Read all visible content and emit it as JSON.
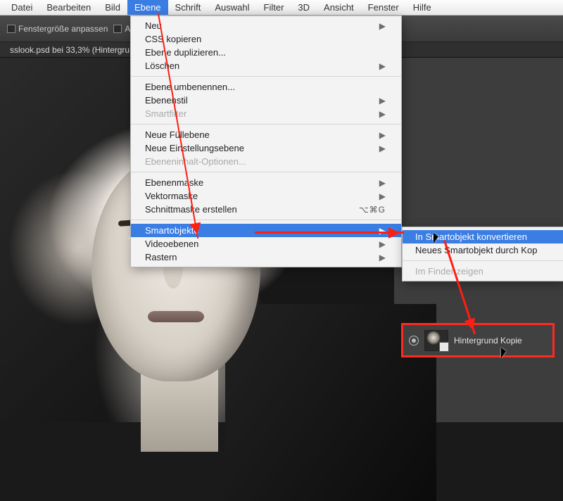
{
  "menubar": {
    "items": [
      "Datei",
      "Bearbeiten",
      "Bild",
      "Ebene",
      "Schrift",
      "Auswahl",
      "Filter",
      "3D",
      "Ansicht",
      "Fenster",
      "Hilfe"
    ],
    "active_index": 3
  },
  "toolbar": {
    "fit_window": "Fenstergröße anpassen",
    "all_windows": "Alle Fenster"
  },
  "document_tab": "sslook.psd bei 33,3% (Hintergrun",
  "dropdown": {
    "groups": [
      [
        {
          "label": "Neu",
          "sub": "▶"
        },
        {
          "label": "CSS kopieren"
        },
        {
          "label": "Ebene duplizieren..."
        },
        {
          "label": "Löschen",
          "sub": "▶"
        }
      ],
      [
        {
          "label": "Ebene umbenennen..."
        },
        {
          "label": "Ebenenstil",
          "sub": "▶"
        },
        {
          "label": "Smartfilter",
          "sub": "▶",
          "disabled": true
        }
      ],
      [
        {
          "label": "Neue Füllebene",
          "sub": "▶"
        },
        {
          "label": "Neue Einstellungsebene",
          "sub": "▶"
        },
        {
          "label": "Ebeneninhalt-Optionen...",
          "disabled": true
        }
      ],
      [
        {
          "label": "Ebenenmaske",
          "sub": "▶"
        },
        {
          "label": "Vektormaske",
          "sub": "▶"
        },
        {
          "label": "Schnittmaske erstellen",
          "shortcut": "⌥⌘G"
        }
      ],
      [
        {
          "label": "Smartobjekte",
          "sub": "▶",
          "highlight": true
        },
        {
          "label": "Videoebenen",
          "sub": "▶"
        },
        {
          "label": "Rastern",
          "sub": "▶"
        }
      ]
    ]
  },
  "submenu": {
    "items": [
      {
        "label": "In Smartobjekt konvertieren",
        "highlight": true
      },
      {
        "label": "Neues Smartobjekt durch Kop"
      },
      {
        "label": "Im Finder zeigen",
        "disabled": true
      }
    ]
  },
  "layer_panel": {
    "layer_name": "Hintergrund Kopie"
  }
}
